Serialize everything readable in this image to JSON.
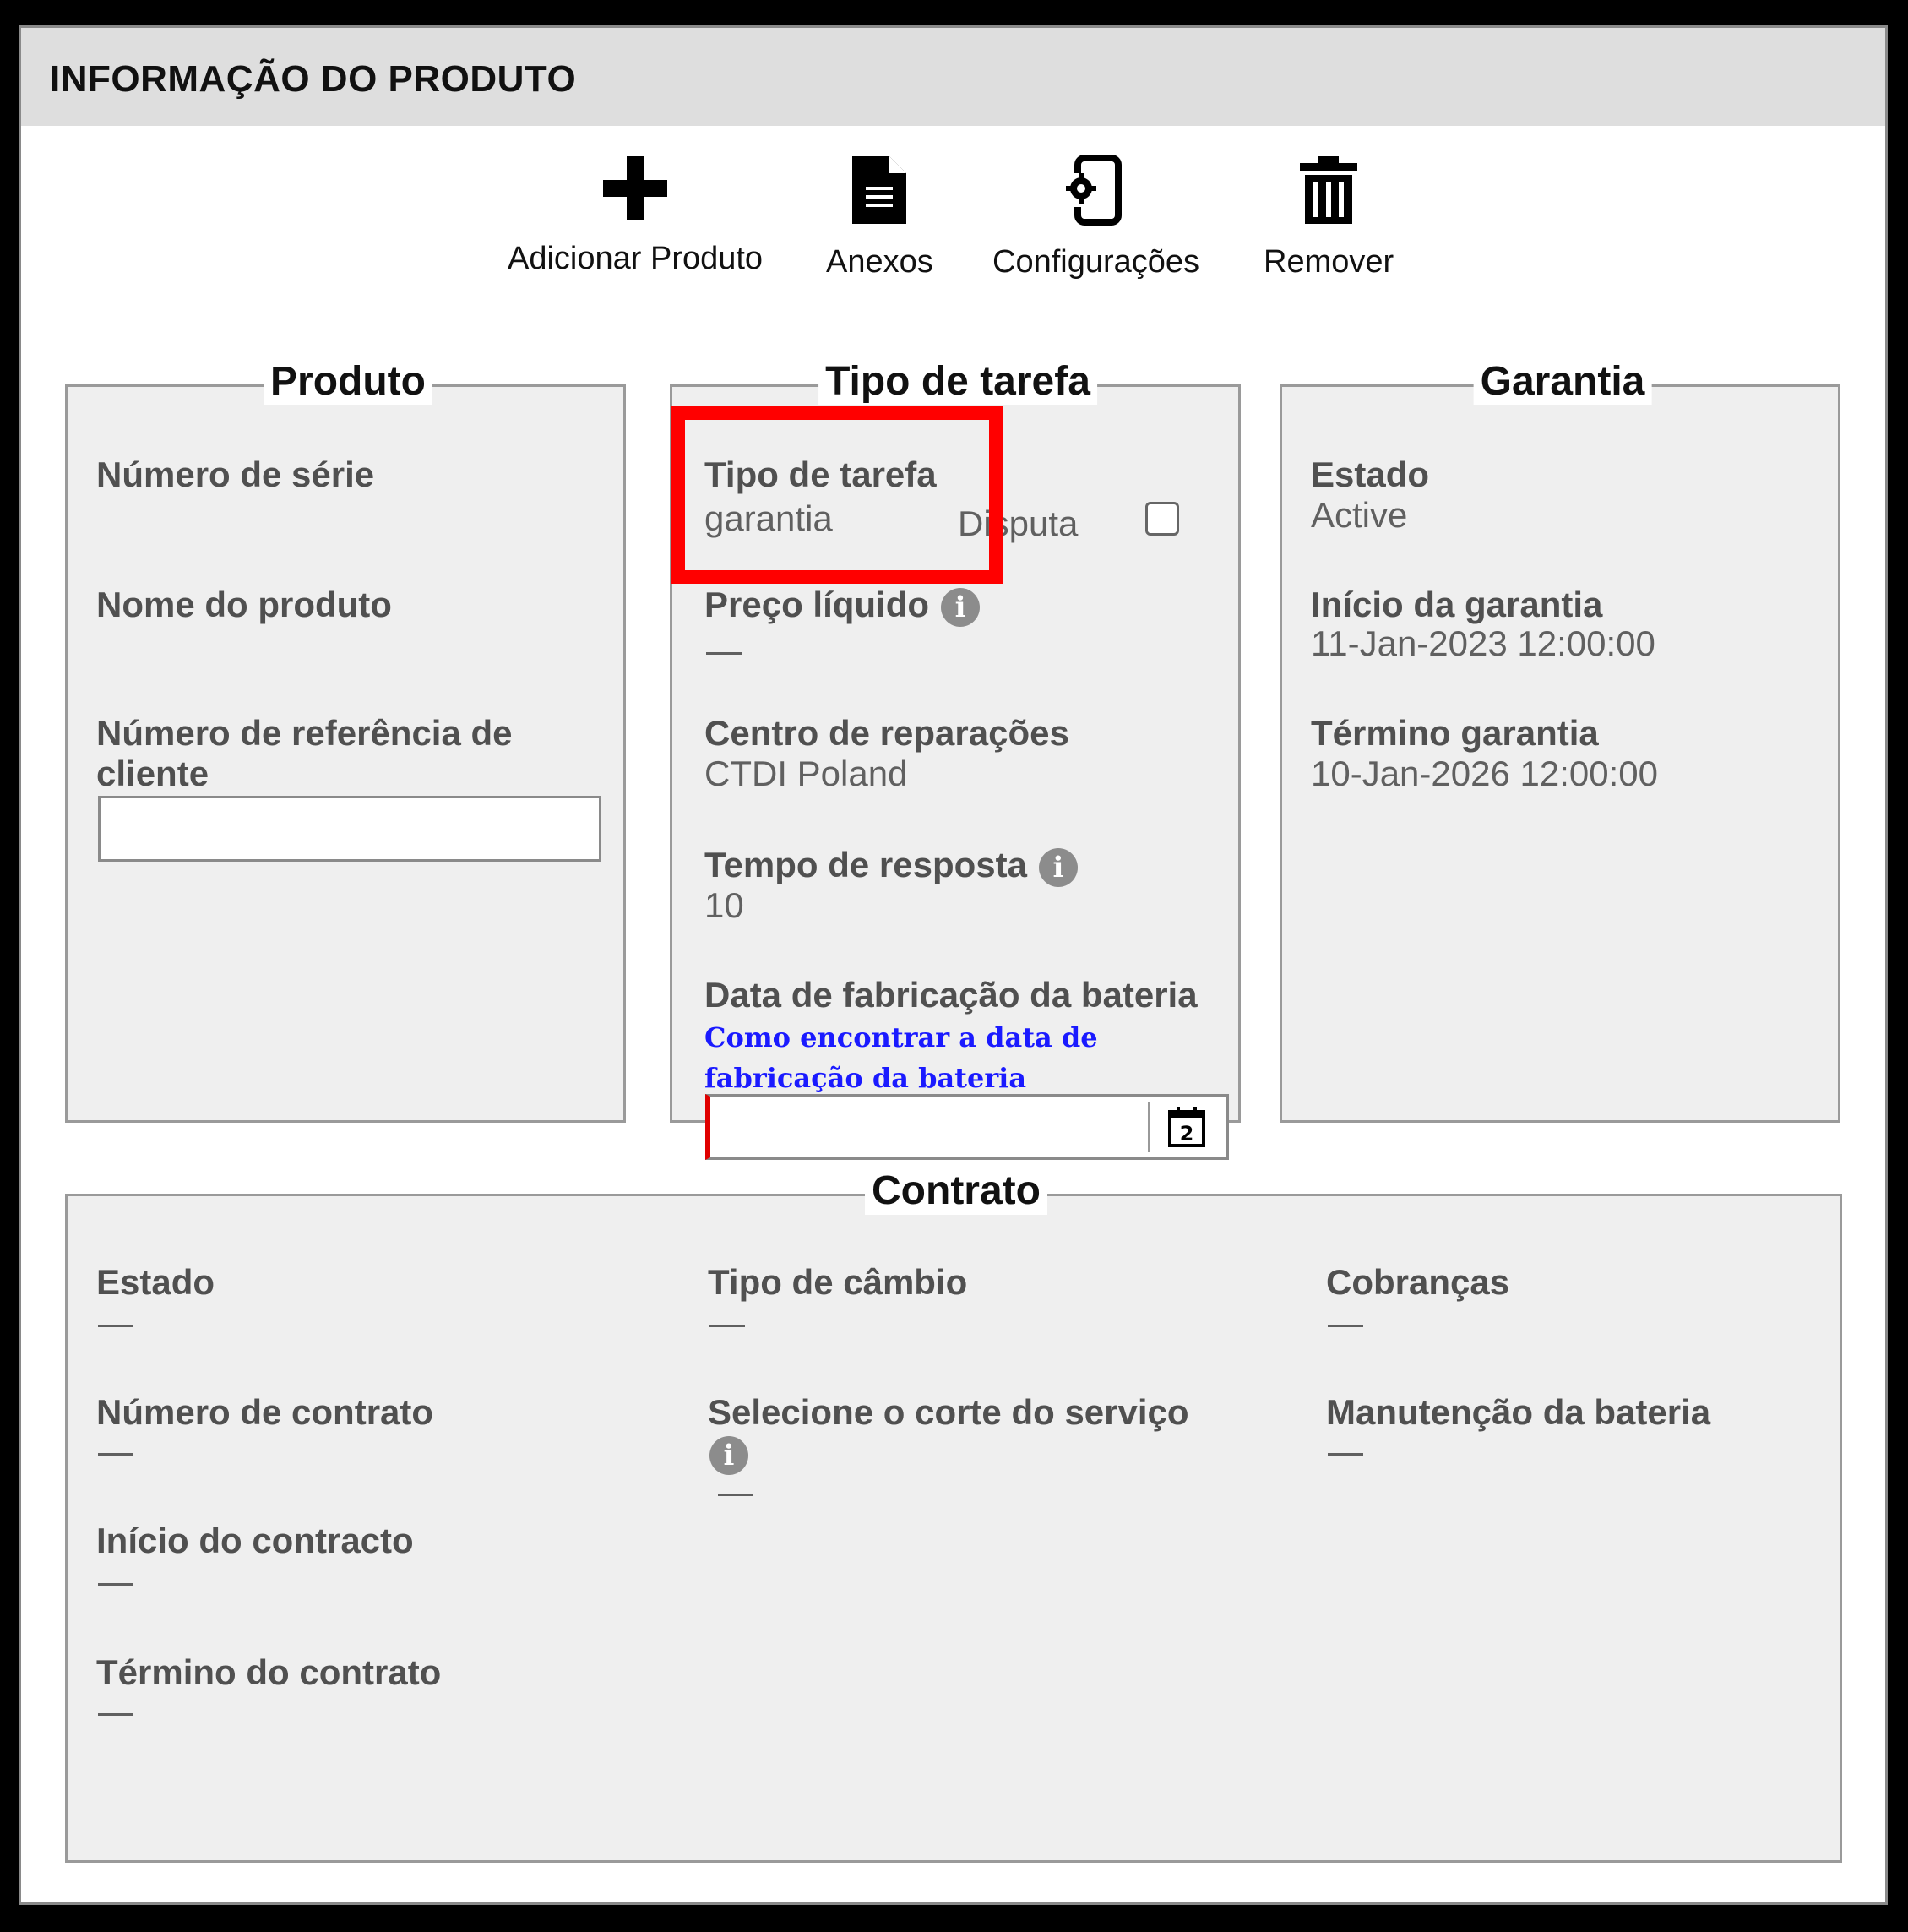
{
  "header": {
    "title": "INFORMAÇÃO DO PRODUTO"
  },
  "toolbar": {
    "add_label": "Adicionar Produto",
    "attachments_label": "Anexos",
    "settings_label": "Configurações",
    "remove_label": "Remover"
  },
  "produto": {
    "legend": "Produto",
    "serial_label": "Número de série",
    "name_label": "Nome do produto",
    "customer_ref_label_line1": "Número de referência de",
    "customer_ref_label_line2": "cliente",
    "customer_ref_value": ""
  },
  "tipo": {
    "legend": "Tipo de tarefa",
    "task_type_label": "Tipo de tarefa",
    "task_type_value": "garantia",
    "dispute_label": "Disputa",
    "net_price_label": "Preço líquido",
    "repair_center_label": "Centro de reparações",
    "repair_center_value": "CTDI Poland",
    "response_time_label": "Tempo de resposta",
    "response_time_value": "10",
    "battery_date_label": "Data de fabricação da bateria",
    "battery_link": "Como encontrar a data de fabricação da bateria",
    "battery_date_value": ""
  },
  "garantia": {
    "legend": "Garantia",
    "state_label": "Estado",
    "state_value": "Active",
    "start_label": "Início da garantia",
    "start_value": "11-Jan-2023 12:00:00",
    "end_label": "Término garantia",
    "end_value": "10-Jan-2026 12:00:00"
  },
  "contrato": {
    "legend": "Contrato",
    "state_label": "Estado",
    "contract_number_label": "Número de contrato",
    "start_label": "Início do contracto",
    "end_label": "Término do contrato",
    "exchange_type_label": "Tipo de câmbio",
    "service_cut_label": "Selecione o corte do serviço",
    "charges_label": "Cobranças",
    "battery_maintenance_label": "Manutenção da bateria"
  },
  "colors": {
    "highlight": "#ff0000",
    "link": "#1a1aff",
    "panel": "#efefef",
    "header": "#dedede"
  },
  "icons": {
    "add": "plus-icon",
    "attachments": "document-icon",
    "settings": "device-gear-icon",
    "remove": "trash-icon",
    "info": "info-icon",
    "calendar": "calendar-icon"
  }
}
